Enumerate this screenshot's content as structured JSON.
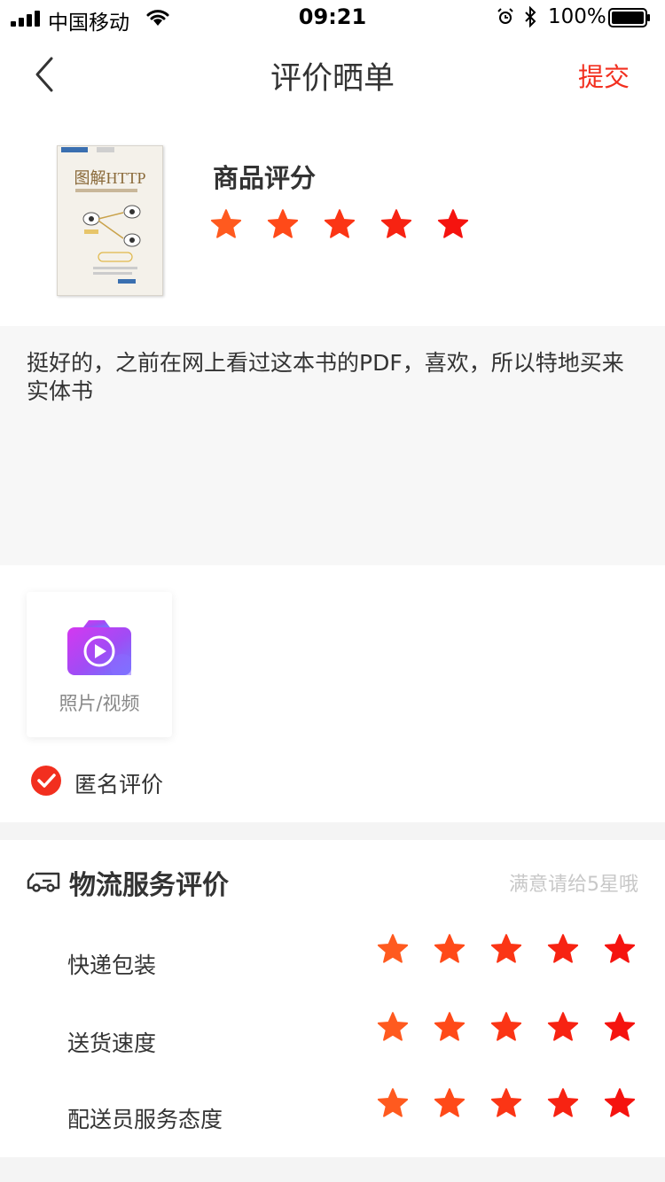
{
  "status_bar": {
    "carrier": "中国移动",
    "time": "09:21",
    "battery": "100%"
  },
  "nav": {
    "title": "评价晒单",
    "submit_label": "提交"
  },
  "product": {
    "cover_title": "图解HTTP",
    "rating_label": "商品评分",
    "rating": 5
  },
  "comment": {
    "text": "挺好的，之前在网上看过这本书的PDF，喜欢，所以特地买来实体书"
  },
  "media": {
    "label": "照片/视频"
  },
  "anonymous": {
    "label": "匿名评价",
    "checked": true
  },
  "logistics": {
    "title": "物流服务评价",
    "hint": "满意请给5星哦",
    "rows": [
      {
        "label": "快递包装",
        "rating": 5
      },
      {
        "label": "送货速度",
        "rating": 5
      },
      {
        "label": "配送员服务态度",
        "rating": 5
      }
    ]
  },
  "colors": {
    "accent": "#f22f1f",
    "star_gradient": [
      "#ff5a1f",
      "#ff4a19",
      "#fb3515",
      "#f72312",
      "#f5130f"
    ]
  }
}
